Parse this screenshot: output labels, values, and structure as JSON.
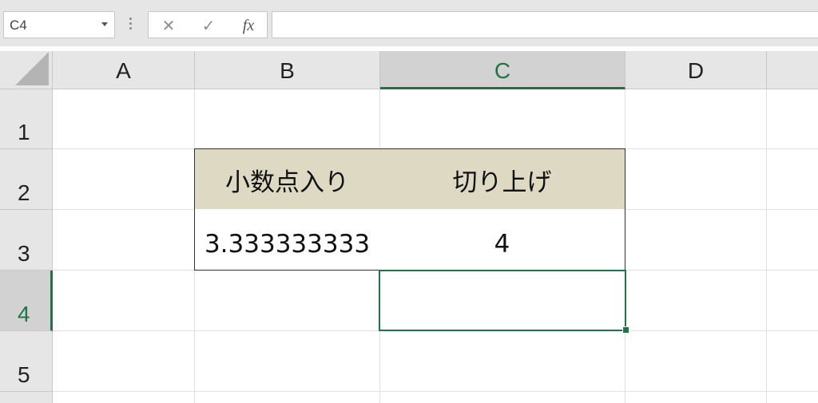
{
  "formula_bar": {
    "name_box_value": "C4",
    "cancel_symbol": "✕",
    "enter_symbol": "✓",
    "fx_label": "fx",
    "formula_value": ""
  },
  "columns": [
    {
      "label": "A"
    },
    {
      "label": "B"
    },
    {
      "label": "C"
    },
    {
      "label": "D"
    }
  ],
  "rows": [
    {
      "label": "1"
    },
    {
      "label": "2"
    },
    {
      "label": "3"
    },
    {
      "label": "4"
    },
    {
      "label": "5"
    }
  ],
  "cells": {
    "B2": "小数点入り",
    "C2": "切り上げ",
    "B3": "3.333333333",
    "C3": "4"
  },
  "selection": {
    "active_cell": "C4",
    "accent_color": "#217346"
  },
  "colors": {
    "header_fill": "#ddd9c3",
    "selected_header": "#217346"
  }
}
